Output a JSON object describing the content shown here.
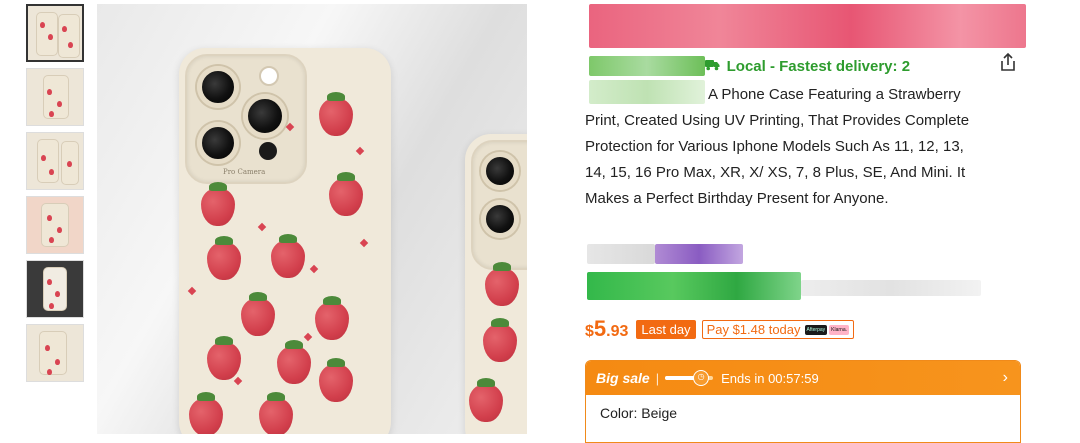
{
  "gallery": {
    "thumbnails": [
      {
        "name": "thumb-1",
        "active": true
      },
      {
        "name": "thumb-2",
        "active": false
      },
      {
        "name": "thumb-3",
        "active": false
      },
      {
        "name": "thumb-4",
        "active": false
      },
      {
        "name": "thumb-5",
        "active": false
      },
      {
        "name": "thumb-6",
        "active": false
      }
    ],
    "case_brand_text": "Pro Camera"
  },
  "product": {
    "delivery_text": "Local - Fastest delivery: 2",
    "description": "A Phone Case Featuring a Strawberry Print, Created Using UV Printing, That Provides Complete Protection for Various Iphone Models Such As 11, 12, 13, 14, 15, 16 Pro Max, XR, X/ XS, 7, 8 Plus, SE, And Mini. It Makes a Perfect Birthday Present for Anyone.",
    "price": {
      "currency": "$",
      "integer": "5",
      "decimal": ".93"
    },
    "last_day_label": "Last day",
    "pay_later_label": "Pay $1.48 today",
    "afterpay_label": "Afterpay",
    "klarna_label": "Klarna."
  },
  "sale": {
    "label": "Big sale",
    "separator": "|",
    "countdown_text": "Ends in 00:57:59",
    "progress_fraction": 0.75
  },
  "selection": {
    "color_text": "Color: Beige"
  },
  "colors": {
    "accent": "#f26a12",
    "delivery_green": "#2e9c2e",
    "sale_orange": "#f7941d"
  },
  "icons": {
    "share": "share-icon",
    "truck": "truck-icon",
    "chevron": "chevron-right-icon"
  }
}
